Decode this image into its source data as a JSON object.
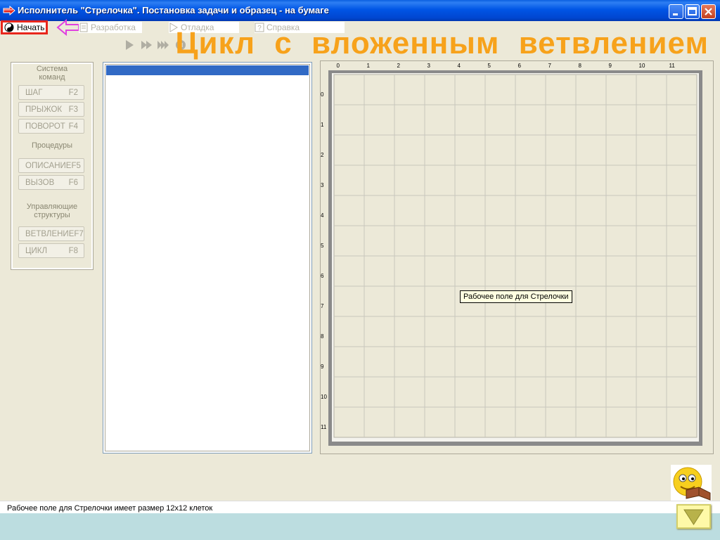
{
  "window": {
    "title": "Исполнитель \"Стрелочка\". Постановка задачи и образец - на бумаге",
    "buttons": [
      "minimize-icon",
      "maximize-icon",
      "close-icon"
    ]
  },
  "menu": {
    "start": "Начать",
    "items": [
      "Разработка",
      "Отладка",
      "Справка"
    ]
  },
  "heading": "Цикл  с  вложенным  ветвлением",
  "commands": {
    "title_line1": "Система",
    "title_line2": "команд",
    "buttons": [
      {
        "label": "ШАГ",
        "key": "F2"
      },
      {
        "label": "ПРЫЖОК",
        "key": "F3"
      },
      {
        "label": "ПОВОРОТ",
        "key": "F4"
      }
    ],
    "procedures_title": "Процедуры",
    "procedure_buttons": [
      {
        "label": "ОПИСАНИЕ",
        "key": "F5"
      },
      {
        "label": "ВЫЗОВ",
        "key": "F6"
      }
    ],
    "control_title_line1": "Управляющие",
    "control_title_line2": "структуры",
    "control_buttons": [
      {
        "label": "ВЕТВЛЕНИЕ",
        "key": "F7"
      },
      {
        "label": "ЦИКЛ",
        "key": "F8"
      }
    ]
  },
  "field": {
    "columns": [
      "0",
      "1",
      "2",
      "3",
      "4",
      "5",
      "6",
      "7",
      "8",
      "9",
      "10",
      "11"
    ],
    "rows": [
      "0",
      "1",
      "2",
      "3",
      "4",
      "5",
      "6",
      "7",
      "8",
      "9",
      "10",
      "11"
    ],
    "tooltip": "Рабочее поле для Стрелочки"
  },
  "status": "Рабочее поле для Стрелочки имеет размер 12х12 клеток",
  "colors": {
    "heading": "#f7a21b",
    "selection": "#316ac5",
    "highlight_border": "#e8261c",
    "pointer": "#e040e0"
  }
}
